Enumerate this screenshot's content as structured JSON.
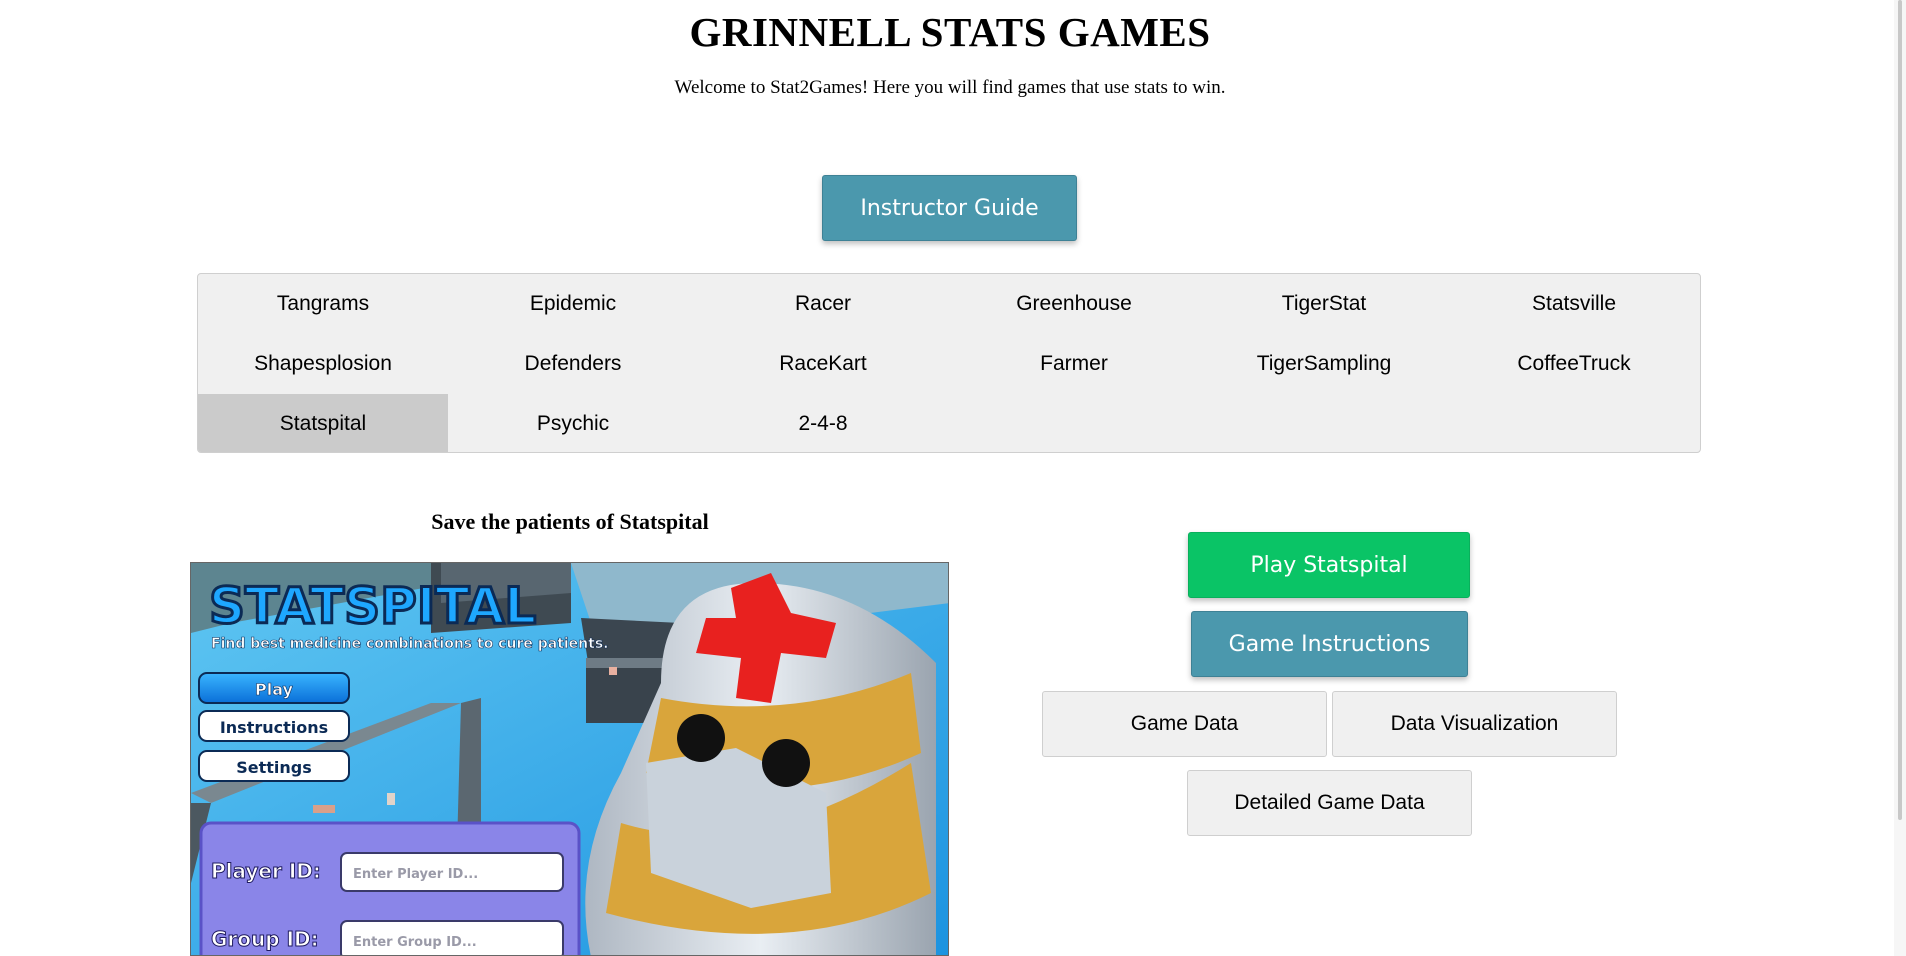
{
  "header": {
    "title": "GRINNELL STATS GAMES",
    "welcome": "Welcome to Stat2Games! Here you will find games that use stats to win."
  },
  "instructor_guide_label": "Instructor Guide",
  "tabs": [
    "Tangrams",
    "Epidemic",
    "Racer",
    "Greenhouse",
    "TigerStat",
    "Statsville",
    "Shapesplosion",
    "Defenders",
    "RaceKart",
    "Farmer",
    "TigerSampling",
    "CoffeeTruck",
    "Statspital",
    "Psychic",
    "2-4-8"
  ],
  "active_tab": "Statspital",
  "game": {
    "heading": "Save the patients of Statspital",
    "screenshot": {
      "logo": "STATSPITAL",
      "tagline": "Find best medicine combinations to cure patients.",
      "menu": [
        "Play",
        "Instructions",
        "Settings"
      ],
      "player_label": "Player ID:",
      "player_placeholder": "Enter Player ID...",
      "group_label": "Group ID:",
      "group_placeholder": "Enter Group ID..."
    }
  },
  "actions": {
    "play": "Play Statspital",
    "instructions": "Game Instructions",
    "game_data": "Game Data",
    "data_viz": "Data Visualization",
    "detailed": "Detailed Game Data"
  },
  "colors": {
    "teal": "#4b98ad",
    "green": "#0ac466",
    "gray": "#f0f0f0"
  }
}
